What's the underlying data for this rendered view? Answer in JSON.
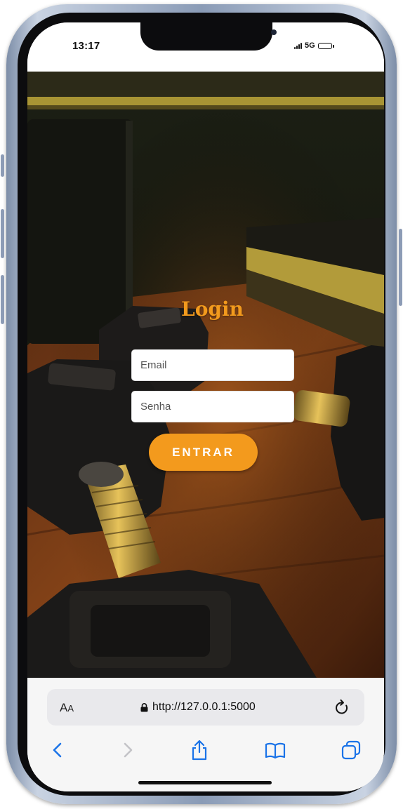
{
  "status_bar": {
    "time": "13:17",
    "network": "5G"
  },
  "login": {
    "title": "Login",
    "email_placeholder": "Email",
    "password_placeholder": "Senha",
    "submit_label": "ENTRAR"
  },
  "browser": {
    "text_size_label": "A",
    "text_size_label_small": "A",
    "url": "http://127.0.0.1:5000",
    "icons": [
      "lock-icon",
      "reload-icon",
      "back-icon",
      "forward-icon",
      "share-icon",
      "bookmarks-icon",
      "tabs-icon"
    ]
  },
  "colors": {
    "accent": "#f39a1d",
    "browser_blue": "#1a73e8"
  }
}
